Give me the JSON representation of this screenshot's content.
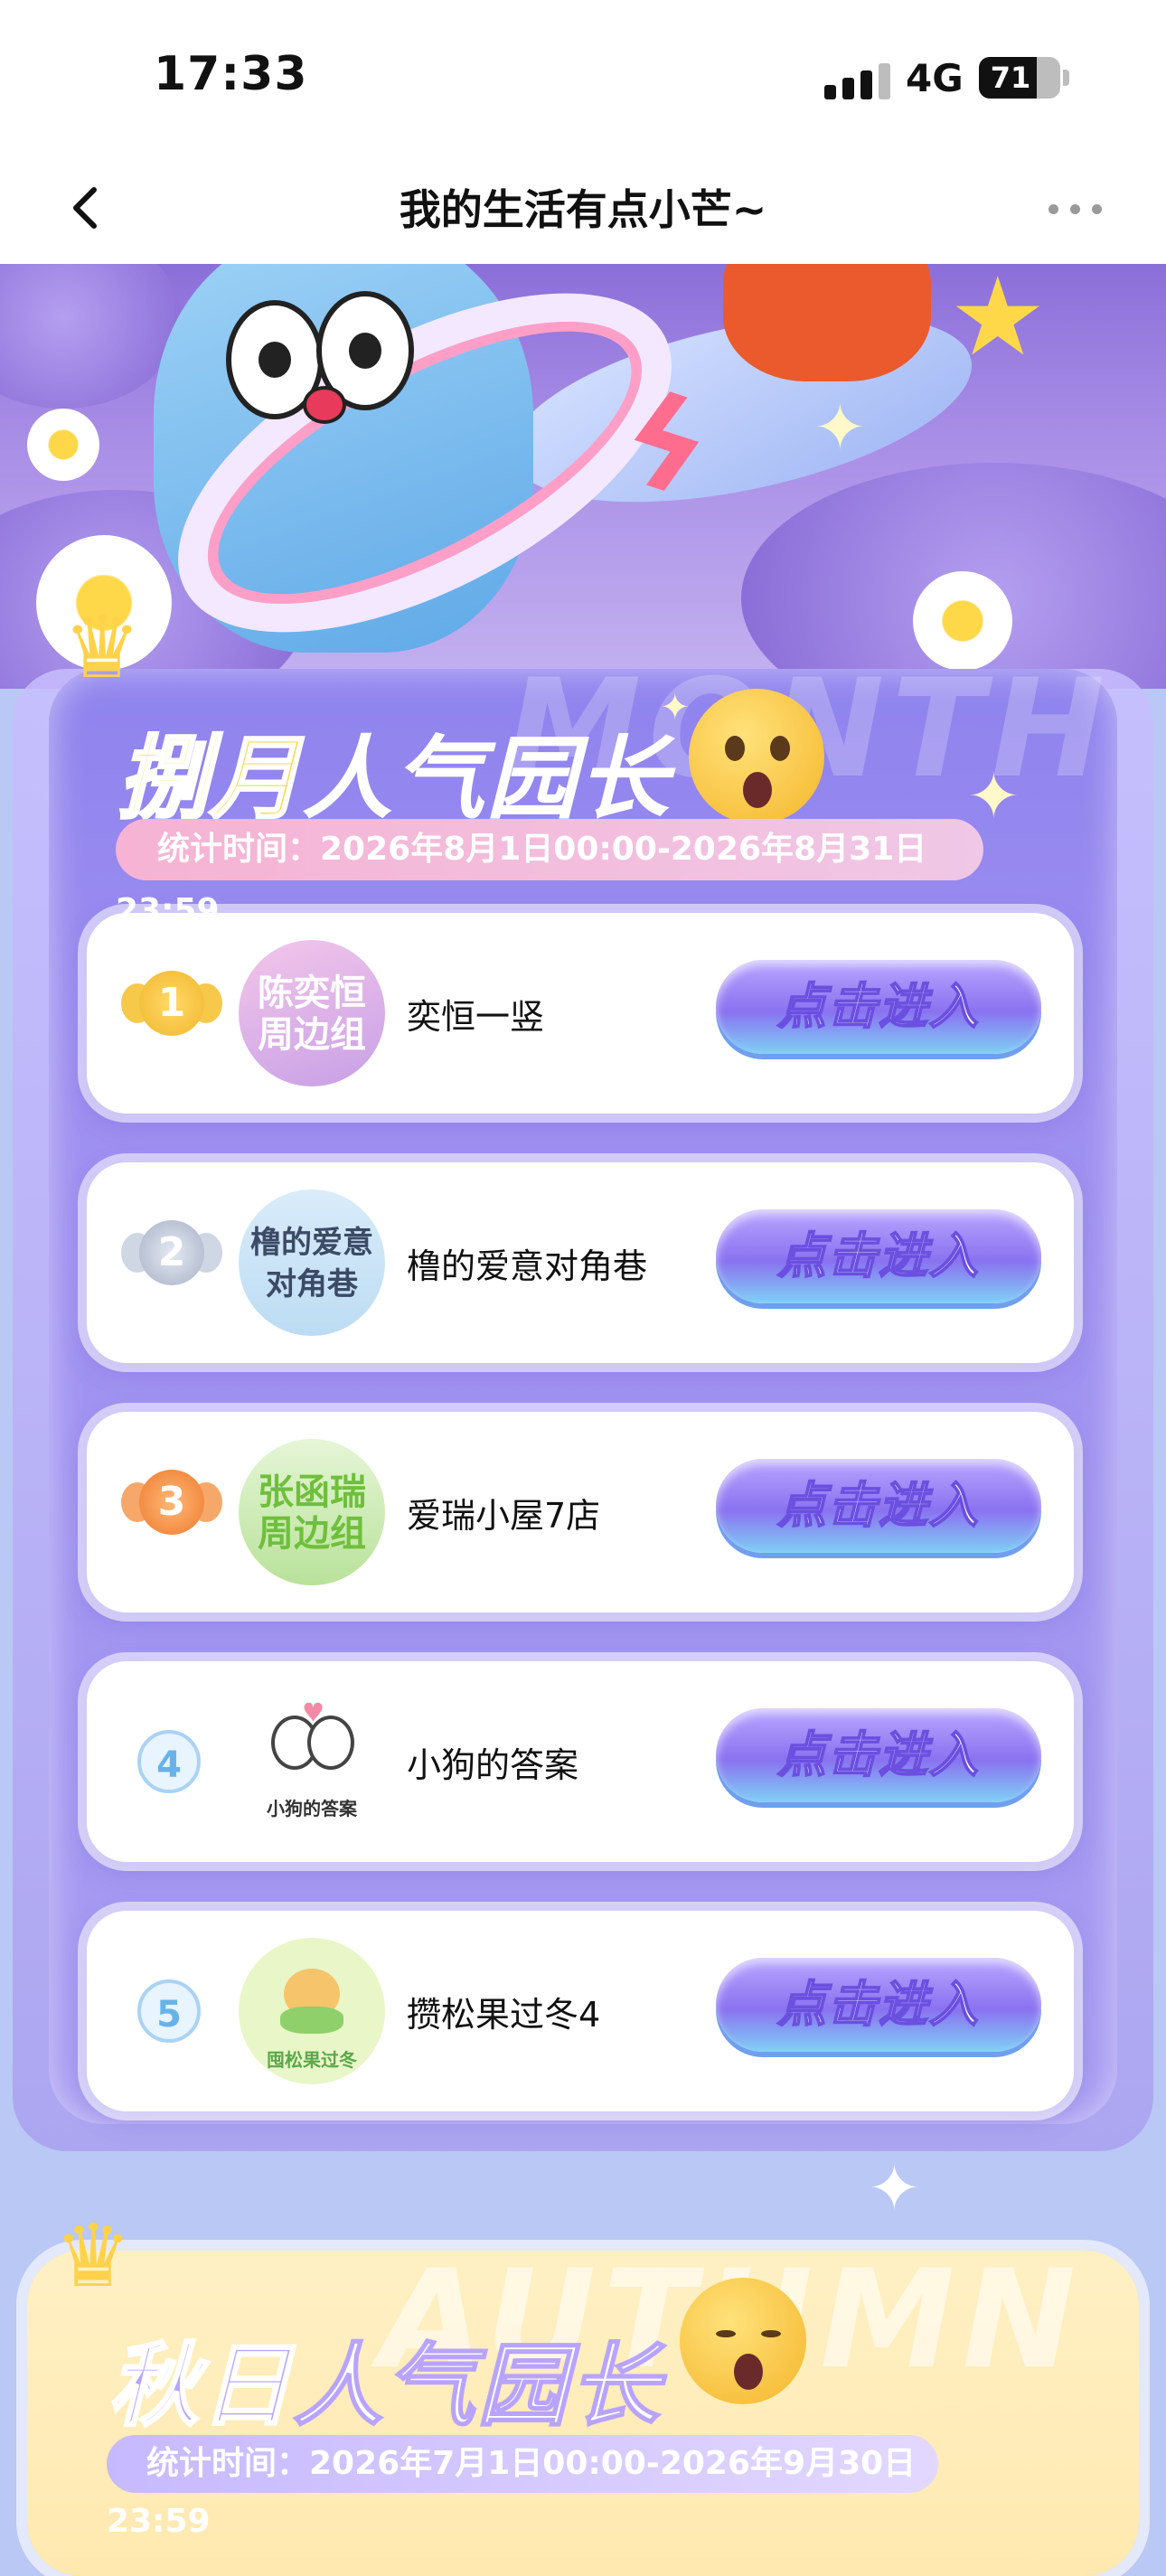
{
  "status_bar": {
    "time": "17:33",
    "network": "4G",
    "battery": "71",
    "battery_level": 0.71
  },
  "nav": {
    "back_icon": "chevron-left-icon",
    "title": "我的生活有点小芒~",
    "more_icon": "more-dots-icon"
  },
  "ranking_month": {
    "ghost_text": "MONTH",
    "title_part1": "捌月",
    "title_part2": "人气园长",
    "period": "统计时间：2026年8月1日00:00-2026年8月31日23:59",
    "items": [
      {
        "rank": "1",
        "avatar_text": "陈奕恒\n周边组",
        "name": "奕恒一竖",
        "button": "点击进入"
      },
      {
        "rank": "2",
        "avatar_text": "橹的爱意\n对角巷",
        "name": "橹的爱意对角巷",
        "button": "点击进入"
      },
      {
        "rank": "3",
        "avatar_text": "张函瑞\n周边组",
        "name": "爱瑞小屋7店",
        "button": "点击进入"
      },
      {
        "rank": "4",
        "avatar_text": "小狗的答案",
        "name": "小狗的答案",
        "button": "点击进入"
      },
      {
        "rank": "5",
        "avatar_text": "囤松果过冬",
        "name": "攒松果过冬4",
        "button": "点击进入"
      }
    ]
  },
  "ranking_autumn": {
    "ghost_text": "AUTUMN",
    "title_part1": "秋日",
    "title_part2": "人气园长",
    "period": "统计时间：2026年7月1日00:00-2026年9月30日23:59"
  },
  "colors": {
    "gold": "#f2b62c",
    "silver": "#b9c2d6",
    "bronze": "#f08a3e",
    "button_purple": "#8a72f0"
  }
}
